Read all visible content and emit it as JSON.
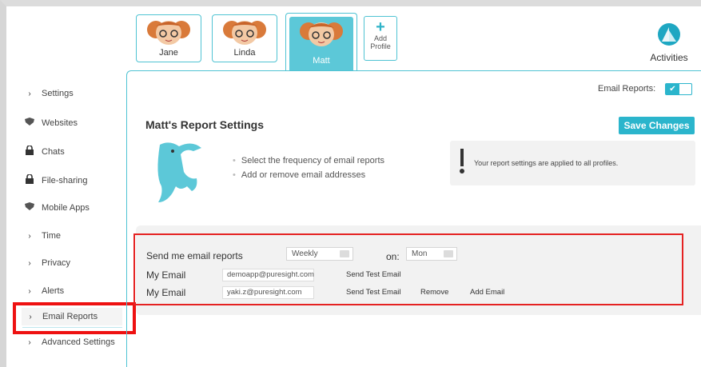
{
  "profiles": [
    {
      "name": "Jane",
      "active": false
    },
    {
      "name": "Linda",
      "active": false
    },
    {
      "name": "Matt",
      "active": true
    }
  ],
  "add_profile": {
    "plus": "+",
    "line1": "Add",
    "line2": "Profile"
  },
  "activities": {
    "label": "Activities"
  },
  "sidebar": {
    "items": [
      {
        "label": "Settings",
        "icon": "chevron-right-icon"
      },
      {
        "label": "Websites",
        "icon": "shield-icon"
      },
      {
        "label": "Chats",
        "icon": "lock-icon"
      },
      {
        "label": "File-sharing",
        "icon": "lock-icon"
      },
      {
        "label": "Mobile Apps",
        "icon": "shield-icon"
      },
      {
        "label": "Time",
        "icon": "chevron-right-icon"
      },
      {
        "label": "Privacy",
        "icon": "chevron-right-icon"
      },
      {
        "label": "Alerts",
        "icon": "chevron-right-icon"
      },
      {
        "label": "Email Reports",
        "icon": "chevron-right-icon"
      },
      {
        "label": "Advanced Settings",
        "icon": "chevron-right-icon"
      }
    ]
  },
  "header": {
    "email_reports_label": "Email Reports:",
    "toggle_check": "✔"
  },
  "main": {
    "title": "Matt's Report Settings",
    "save_label": "Save Changes",
    "bullets": [
      "Select the frequency of email reports",
      "Add or remove email addresses"
    ],
    "notice": "Your report settings are applied to all profiles."
  },
  "form": {
    "send_label": "Send me email reports",
    "frequency": "Weekly",
    "on_label": "on:",
    "day": "Mon",
    "emails": [
      {
        "label": "My Email",
        "value": "demoapp@puresight.com",
        "actions": [
          "Send Test Email"
        ]
      },
      {
        "label": "My Email",
        "value": "yaki.z@puresight.com",
        "actions": [
          "Send Test Email",
          "Remove",
          "Add Email"
        ]
      }
    ]
  },
  "colors": {
    "accent": "#2bb5cc",
    "highlight": "#e52222"
  }
}
